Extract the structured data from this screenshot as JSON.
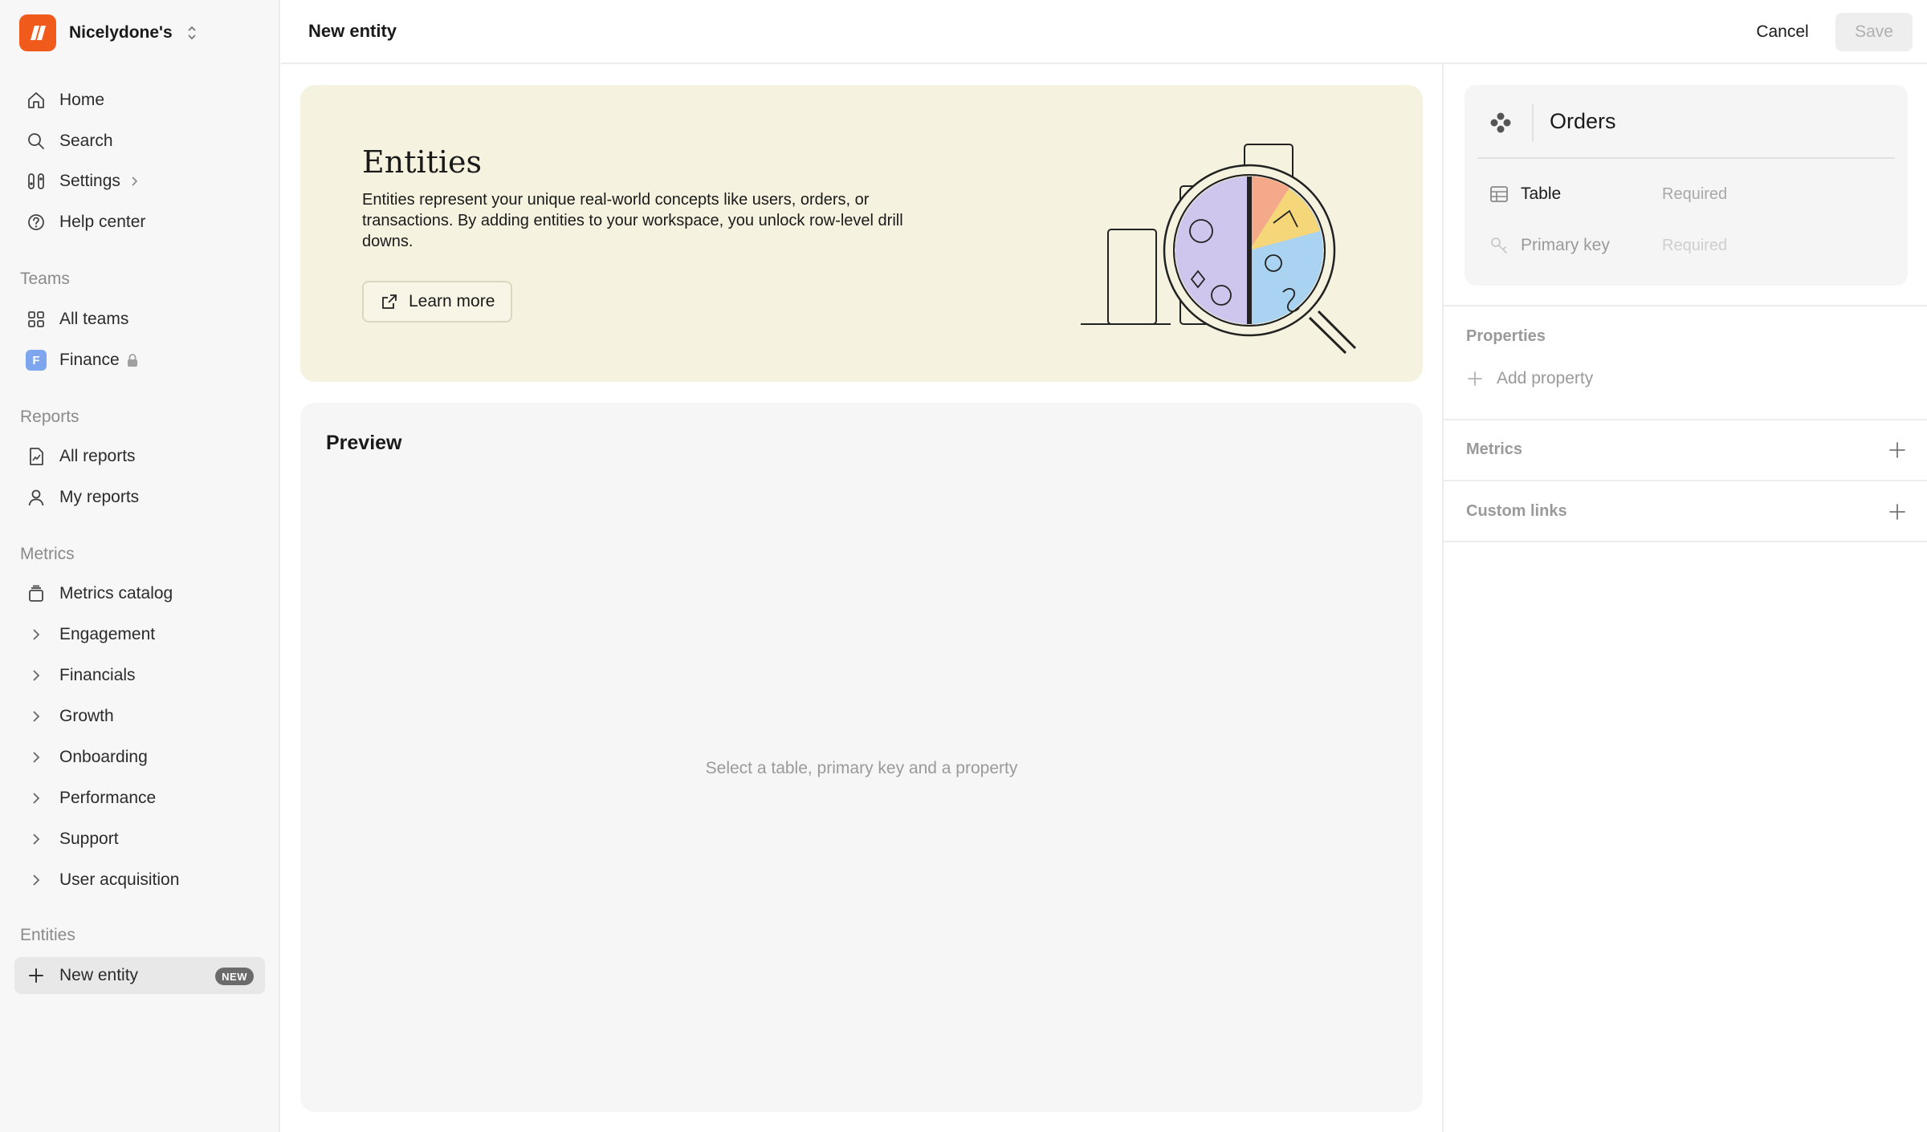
{
  "workspace": {
    "name": "Nicelydone's"
  },
  "nav": {
    "home": "Home",
    "search": "Search",
    "settings": "Settings",
    "help": "Help center"
  },
  "teams": {
    "label": "Teams",
    "all_teams": "All teams",
    "finance": "Finance",
    "finance_initial": "F"
  },
  "reports": {
    "label": "Reports",
    "all_reports": "All reports",
    "my_reports": "My reports"
  },
  "metrics": {
    "label": "Metrics",
    "catalog": "Metrics catalog",
    "items": [
      "Engagement",
      "Financials",
      "Growth",
      "Onboarding",
      "Performance",
      "Support",
      "User acquisition"
    ]
  },
  "entities": {
    "label": "Entities",
    "new_entity": "New entity",
    "badge": "NEW"
  },
  "header": {
    "title": "New entity",
    "cancel": "Cancel",
    "save": "Save"
  },
  "hero": {
    "title": "Entities",
    "description": "Entities represent your unique real-world concepts like users, orders, or transactions. By adding entities to your workspace, you unlock row-level drill downs.",
    "learn_more": "Learn more"
  },
  "preview": {
    "title": "Preview",
    "empty": "Select a table, primary key and a property"
  },
  "entity_card": {
    "name": "Orders",
    "table_label": "Table",
    "table_value": "Required",
    "pk_label": "Primary key",
    "pk_value": "Required"
  },
  "panel": {
    "properties": "Properties",
    "add_property": "Add property",
    "metrics": "Metrics",
    "custom_links": "Custom links"
  },
  "colors": {
    "brand": "#f05a1a",
    "hero_bg": "#f6f2e0",
    "finance_badge": "#7ea6ee"
  }
}
